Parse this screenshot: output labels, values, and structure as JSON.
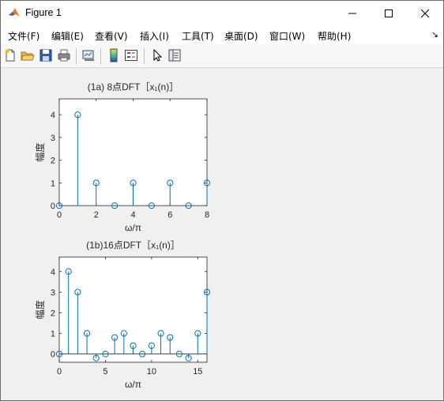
{
  "window": {
    "title": "Figure 1",
    "icon": "matlab-icon",
    "controls": [
      "minimize-icon",
      "maximize-icon",
      "close-icon"
    ]
  },
  "menu": {
    "items": [
      "文件(F)",
      "编辑(E)",
      "查看(V)",
      "插入(I)",
      "工具(T)",
      "桌面(D)",
      "窗口(W)",
      "帮助(H)"
    ],
    "overflow_icon": "arrow-icon"
  },
  "toolbar": {
    "buttons": [
      "new-figure-icon",
      "open-icon",
      "save-icon",
      "print-icon",
      "link-icon",
      "colorbar-icon",
      "legend-icon",
      "pointer-icon",
      "property-inspector-icon"
    ]
  },
  "colors": {
    "stem": "#0072bd",
    "axes": "#262626",
    "background": "#f0f0f0"
  },
  "chart_data": [
    {
      "type": "stem",
      "title": "(1a) 8点DFT［x₁(n)］",
      "xlabel": "ω/π",
      "ylabel": "幅度",
      "x": [
        0,
        1,
        2,
        3,
        4,
        5,
        6,
        7,
        8
      ],
      "values": [
        0,
        4,
        1,
        0,
        1,
        0,
        1,
        0,
        1
      ],
      "xlim": [
        0,
        8
      ],
      "ylim": [
        0,
        4.7
      ],
      "xticks": [
        0,
        2,
        4,
        6,
        8
      ],
      "yticks": [
        0,
        1,
        2,
        3,
        4
      ],
      "grid": false
    },
    {
      "type": "stem",
      "title": "(1b)16点DFT［x₁(n)］",
      "xlabel": "ω/π",
      "ylabel": "幅度",
      "x": [
        0,
        1,
        2,
        3,
        4,
        5,
        6,
        7,
        8,
        9,
        10,
        11,
        12,
        13,
        14,
        15,
        16
      ],
      "values": [
        0,
        4,
        3,
        1,
        -0.2,
        0,
        0.8,
        1,
        0.4,
        0,
        0.4,
        1,
        0.8,
        0,
        -0.2,
        1,
        3
      ],
      "xlim": [
        0,
        16
      ],
      "ylim": [
        -0.4,
        4.7
      ],
      "xticks": [
        0,
        5,
        10,
        15
      ],
      "yticks": [
        0,
        1,
        2,
        3,
        4
      ],
      "grid": false
    }
  ]
}
